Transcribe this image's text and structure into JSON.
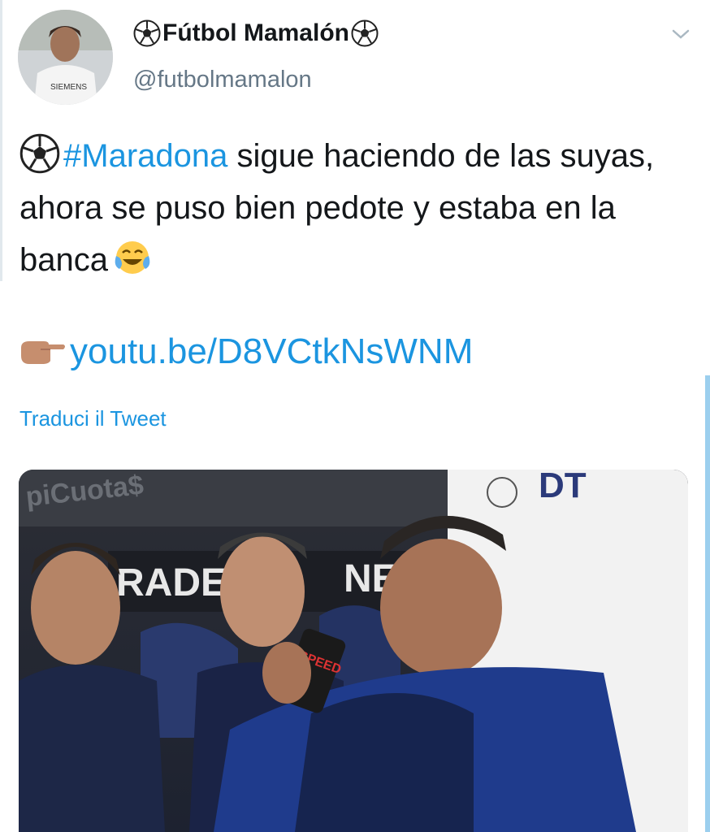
{
  "tweet": {
    "display_name": "Fútbol Mamalón",
    "handle": "@futbolmamalon",
    "text_hashtag": "#Maradona",
    "text_body": " sigue haciendo de las suyas, ahora se puso bien pedote y estaba en la banca",
    "link": "youtu.be/D8VCtkNsWNM",
    "translate_label": "Traduci il Tweet"
  },
  "media": {
    "sign_left_text": "piCuota$",
    "sign_mid_text": "RADE",
    "sign_right_text": "NEF",
    "panel_text": "DT",
    "can_text": "SPEED"
  },
  "icons": {
    "name_prefix": "soccer-ball-icon",
    "name_suffix": "soccer-ball-icon",
    "menu": "chevron-down-icon",
    "laugh": "tears-of-joy-emoji",
    "point": "pointing-hand-emoji"
  },
  "colors": {
    "link": "#1b95e0",
    "text": "#14171a",
    "secondary": "#657786"
  }
}
